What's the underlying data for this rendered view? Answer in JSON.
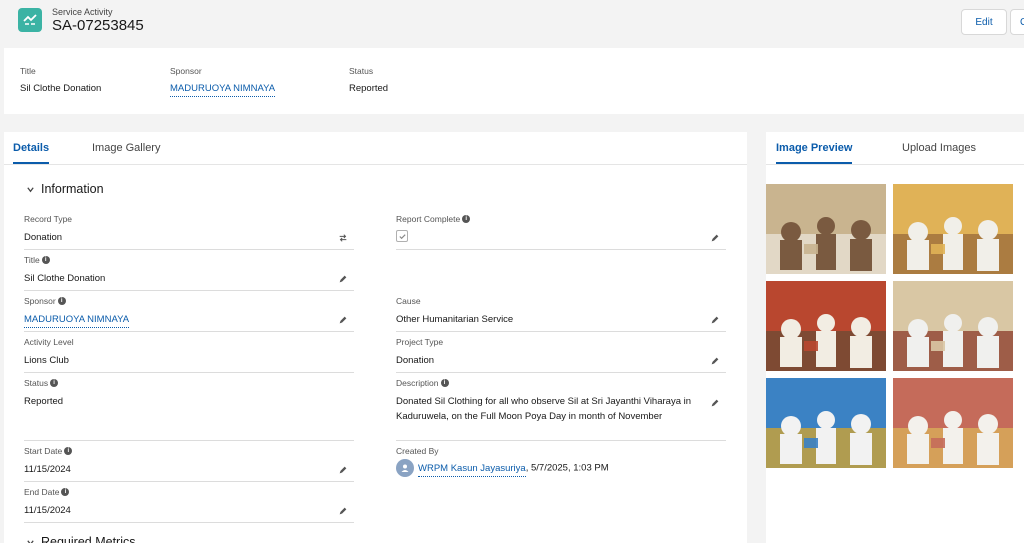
{
  "header": {
    "object_type": "Service Activity",
    "record_name": "SA-07253845",
    "edit_label": "Edit",
    "more_label": "C"
  },
  "highlights": {
    "title_label": "Title",
    "title_value": "Sil Clothe Donation",
    "sponsor_label": "Sponsor",
    "sponsor_value": "MADURUOYA NIMNAYA",
    "status_label": "Status",
    "status_value": "Reported"
  },
  "main": {
    "tabs": [
      {
        "label": "Details",
        "active": true
      },
      {
        "label": "Image Gallery",
        "active": false
      }
    ],
    "section_title": "Information",
    "section2_title": "Required Metrics",
    "fields": {
      "record_type": {
        "label": "Record Type",
        "value": "Donation"
      },
      "title": {
        "label": "Title",
        "value": "Sil Clothe Donation"
      },
      "sponsor": {
        "label": "Sponsor",
        "value": "MADURUOYA NIMNAYA"
      },
      "activity_level": {
        "label": "Activity Level",
        "value": "Lions Club"
      },
      "status": {
        "label": "Status",
        "value": "Reported"
      },
      "start_date": {
        "label": "Start Date",
        "value": "11/15/2024"
      },
      "end_date": {
        "label": "End Date",
        "value": "11/15/2024"
      },
      "report_complete": {
        "label": "Report Complete",
        "checked": true
      },
      "cause": {
        "label": "Cause",
        "value": "Other Humanitarian Service"
      },
      "project_type": {
        "label": "Project Type",
        "value": "Donation"
      },
      "description": {
        "label": "Description",
        "value": "Donated Sil Clothing for all who observe Sil at Sri Jayanthi Viharaya in Kaduruwela, on the Full Moon Poya Day in month of November"
      },
      "created_by": {
        "label": "Created By",
        "user": "WRPM Kasun Jayasuriya",
        "timestamp": ", 5/7/2025, 1:03 PM"
      }
    }
  },
  "side": {
    "tabs": [
      {
        "label": "Image Preview",
        "active": true
      },
      {
        "label": "Upload Images",
        "active": false
      }
    ],
    "images": [
      {
        "name": "photo-1",
        "colors": [
          "#c9b48f",
          "#7a5a40",
          "#e9e4d8"
        ]
      },
      {
        "name": "photo-2",
        "colors": [
          "#e0b257",
          "#f1efe9",
          "#9a6a3a"
        ]
      },
      {
        "name": "photo-3",
        "colors": [
          "#b9472f",
          "#f2ede3",
          "#6b4b35"
        ]
      },
      {
        "name": "photo-4",
        "colors": [
          "#d9c7a4",
          "#f0f0ee",
          "#8a3a2a"
        ]
      },
      {
        "name": "photo-5",
        "colors": [
          "#3b82c4",
          "#f2f2f2",
          "#d8a42a"
        ]
      },
      {
        "name": "photo-6",
        "colors": [
          "#c56b5a",
          "#f3f1ec",
          "#d9b25a"
        ]
      }
    ]
  },
  "colors": {
    "accent": "#0b5cab",
    "app_icon": "#3bb3a4"
  }
}
